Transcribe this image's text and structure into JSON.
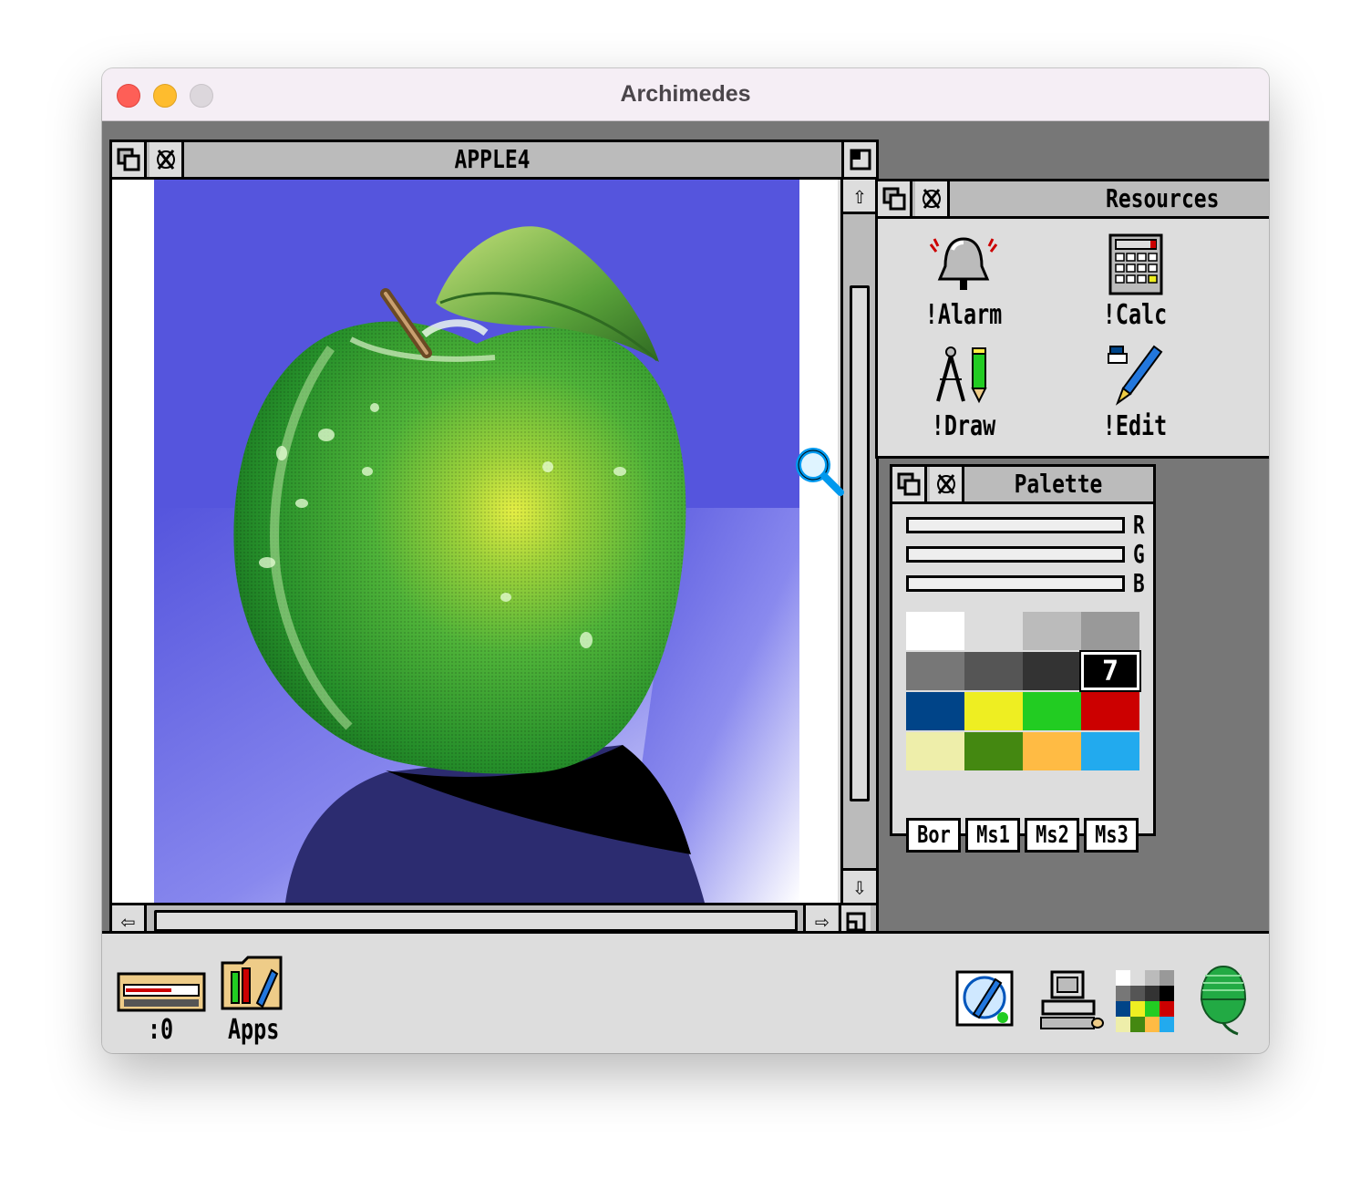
{
  "mac_window": {
    "title": "Archimedes"
  },
  "apple_window": {
    "title": "APPLE4"
  },
  "resources_window": {
    "title": "Resources",
    "apps": [
      {
        "label": "!Alarm",
        "icon": "bell-icon"
      },
      {
        "label": "!Calc",
        "icon": "calculator-icon"
      },
      {
        "label": "!Draw",
        "icon": "compass-pencil-icon"
      },
      {
        "label": "!Edit",
        "icon": "pen-icon"
      }
    ]
  },
  "palette_window": {
    "title": "Palette",
    "sliders": [
      "R",
      "G",
      "B"
    ],
    "selected_index_label": "7",
    "swatches": [
      "#ffffff",
      "#dddddd",
      "#bbbbbb",
      "#999999",
      "#777777",
      "#555555",
      "#333333",
      "#000000",
      "#004488",
      "#eeee22",
      "#22cc22",
      "#cc0000",
      "#eeeeaa",
      "#448811",
      "#ffbb44",
      "#22aaee"
    ],
    "buttons": [
      "Bor",
      "Ms1",
      "Ms2",
      "Ms3"
    ]
  },
  "iconbar": {
    "drive_label": ":0",
    "apps_label": "Apps"
  },
  "colors": {
    "desktop": "#777777",
    "window_background": "#dddddd",
    "title_bar": "#bbbbbb",
    "painting_sky": "#5555dd"
  }
}
